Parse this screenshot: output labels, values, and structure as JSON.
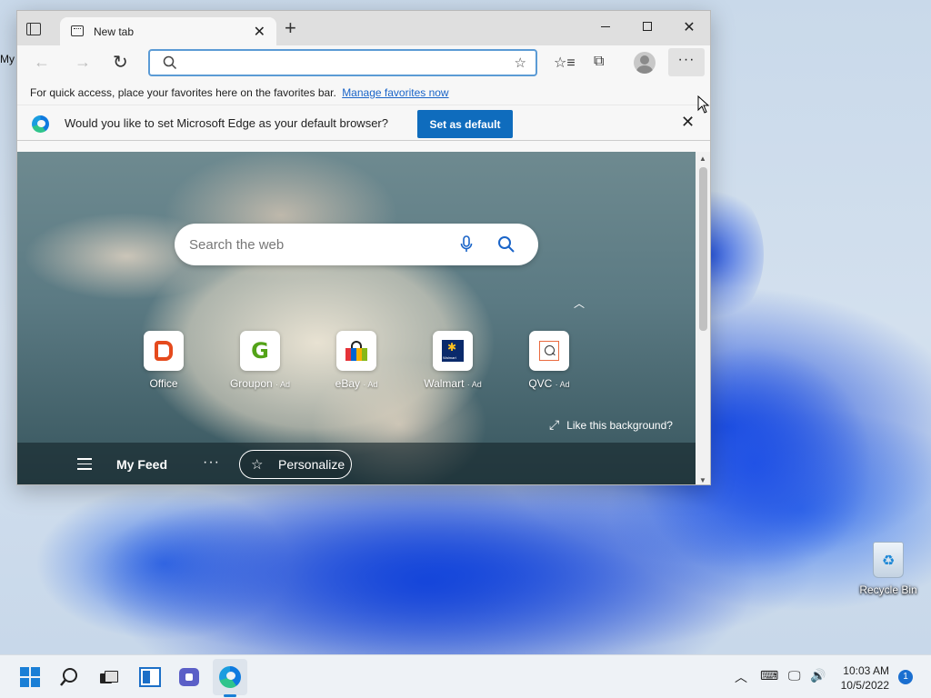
{
  "desktop": {
    "edge_label_fragment": "My",
    "recycle_bin_label": "Recycle Bin"
  },
  "browser": {
    "tab": {
      "title": "New tab"
    },
    "new_tab_glyph": "+",
    "address_bar": {
      "value": "",
      "placeholder": ""
    },
    "favorites_bar": {
      "message": "For quick access, place your favorites here on the favorites bar.",
      "link_text": "Manage favorites now"
    },
    "infobar": {
      "message": "Would you like to set Microsoft Edge as your default browser?",
      "button_label": "Set as default"
    },
    "new_tab_page": {
      "search_placeholder": "Search the web",
      "tiles": [
        {
          "name": "Office",
          "ad": ""
        },
        {
          "name": "Groupon",
          "ad": "· Ad"
        },
        {
          "name": "eBay",
          "ad": "· Ad"
        },
        {
          "name": "Walmart",
          "ad": "· Ad"
        },
        {
          "name": "QVC",
          "ad": "· Ad"
        }
      ],
      "like_background": "Like this background?",
      "feed_label": "My Feed",
      "feed_more": "···",
      "personalize_label": "Personalize"
    },
    "icons": [
      "tab-actions-icon",
      "close-icon",
      "minimize-icon",
      "maximize-icon",
      "back-icon",
      "forward-icon",
      "refresh-icon",
      "search-icon",
      "add-favorite-icon",
      "favorites-icon",
      "collections-icon",
      "profile-icon",
      "more-icon",
      "edge-icon",
      "mic-icon"
    ]
  },
  "taskbar": {
    "time": "10:03 AM",
    "date": "10/5/2022",
    "notification_count": "1"
  },
  "colors": {
    "accent": "#0f6cbd",
    "link": "#1a64c8",
    "taskbar_bg": "#eef2f6",
    "titlebar_bg": "#dfdfdf"
  }
}
